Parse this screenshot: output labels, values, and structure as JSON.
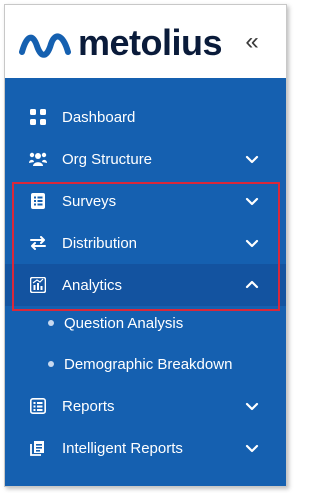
{
  "brand": {
    "name": "metolius",
    "accent_color": "#1560b0"
  },
  "header": {
    "collapse_icon": "double-chevron-left-icon",
    "collapse_glyph": "«"
  },
  "nav": {
    "items": [
      {
        "label": "Dashboard",
        "icon": "grid-icon",
        "has_chevron": false
      },
      {
        "label": "Org Structure",
        "icon": "people-icon",
        "has_chevron": true
      },
      {
        "label": "Surveys",
        "icon": "list-icon",
        "has_chevron": true
      },
      {
        "label": "Distribution",
        "icon": "arrows-exchange-icon",
        "has_chevron": true
      },
      {
        "label": "Analytics",
        "icon": "chart-icon",
        "has_chevron": true,
        "expanded": true
      },
      {
        "label": "Reports",
        "icon": "report-icon",
        "has_chevron": true
      },
      {
        "label": "Intelligent Reports",
        "icon": "document-stack-icon",
        "has_chevron": true
      }
    ],
    "analytics_sub": [
      {
        "label": "Question Analysis"
      },
      {
        "label": "Demographic Breakdown"
      }
    ]
  },
  "highlight_color": "#d9283a"
}
